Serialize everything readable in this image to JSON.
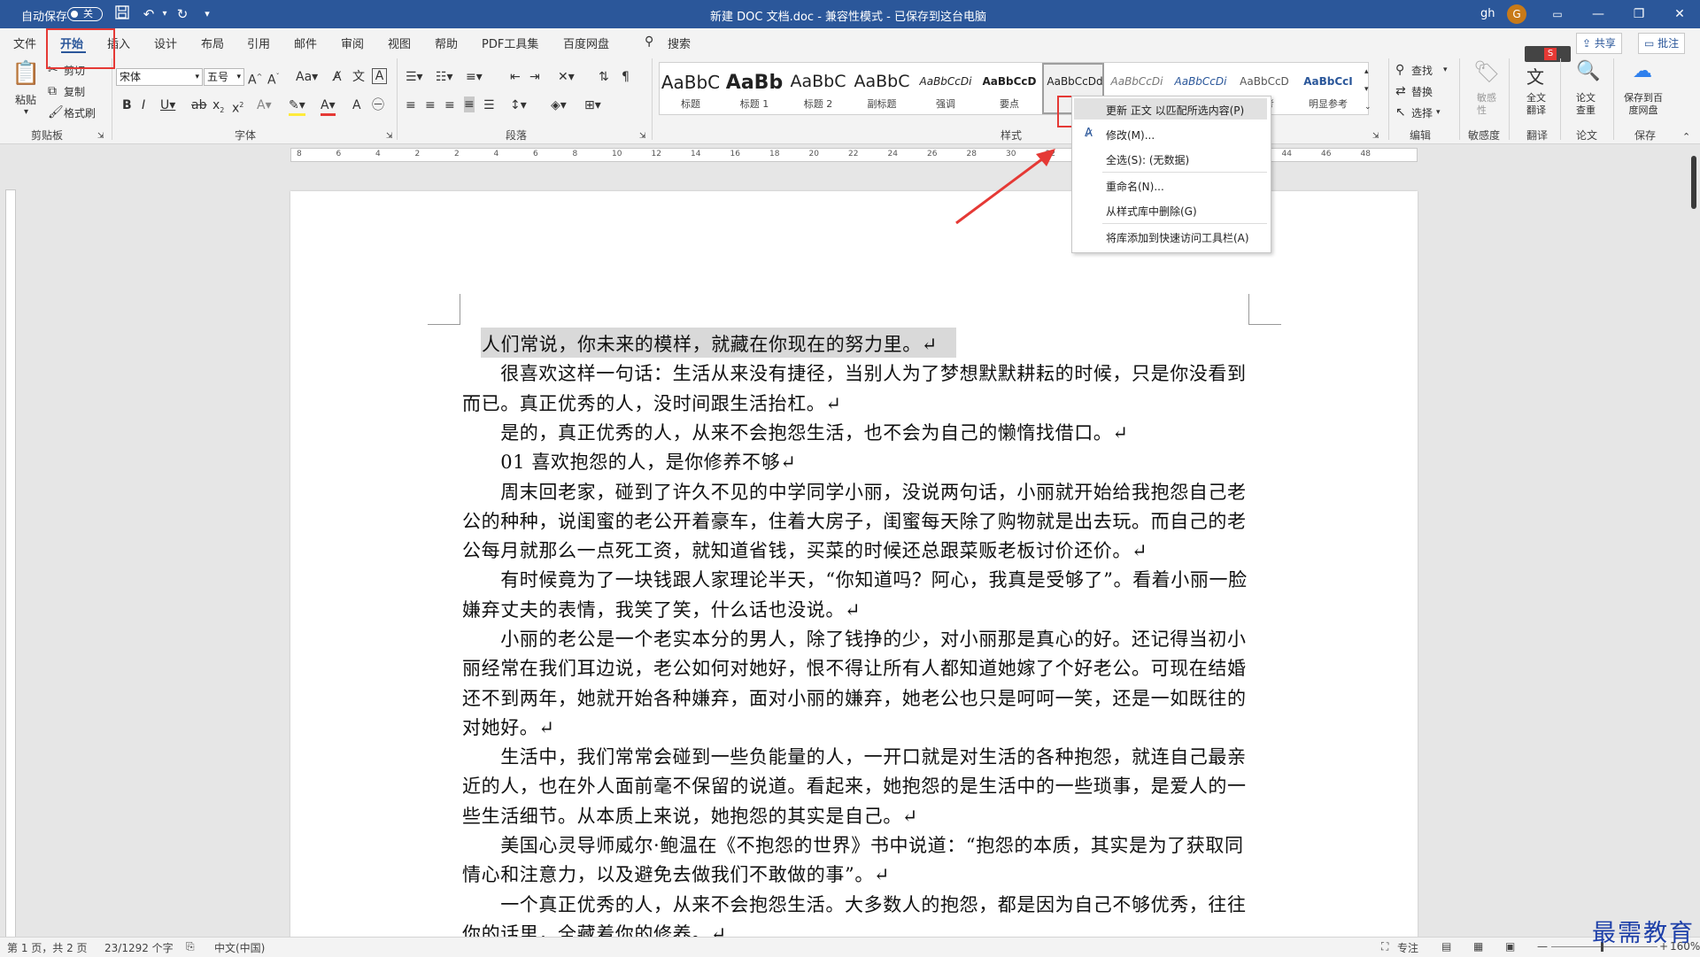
{
  "titlebar": {
    "autosave_label": "自动保存",
    "autosave_state": "关",
    "document_title": "新建 DOC 文档.doc  -  兼容性模式  -  已保存到这台电脑",
    "user_name": "gh",
    "user_initial": "G"
  },
  "tabs": [
    "文件",
    "开始",
    "插入",
    "设计",
    "布局",
    "引用",
    "邮件",
    "审阅",
    "视图",
    "帮助",
    "PDF工具集",
    "百度网盘"
  ],
  "active_tab": "开始",
  "search_label": "搜索",
  "share_label": "共享",
  "comment_label": "批注",
  "clipboard": {
    "paste": "粘贴",
    "cut": "剪切",
    "copy": "复制",
    "format_painter": "格式刷",
    "group_label": "剪贴板"
  },
  "font": {
    "font_name": "宋体",
    "font_size": "五号",
    "group_label": "字体"
  },
  "paragraph": {
    "group_label": "段落"
  },
  "styles": {
    "group_label": "样式",
    "items": [
      {
        "sample": "AaBbC",
        "name": "标题"
      },
      {
        "sample": "AaBb",
        "name": "标题 1"
      },
      {
        "sample": "AaBbC",
        "name": "标题 2"
      },
      {
        "sample": "AaBbC",
        "name": "副标题"
      },
      {
        "sample": "AaBbCcDi",
        "name": "强调"
      },
      {
        "sample": "AaBbCcD",
        "name": "要点"
      },
      {
        "sample": "AaBbCcDd",
        "name": ""
      },
      {
        "sample": "AaBbCcDi",
        "name": ""
      },
      {
        "sample": "AaBbCcDi",
        "name": ""
      },
      {
        "sample": "AaBbCcD",
        "name": "参考"
      },
      {
        "sample": "AaBbCcI",
        "name": "明显参考"
      }
    ]
  },
  "editing": {
    "find": "查找",
    "replace": "替换",
    "select": "选择",
    "group_label": "编辑"
  },
  "sensitivity": {
    "button": "敏感性",
    "group_label": "敏感度"
  },
  "translate": {
    "button": "全文翻译",
    "group_label": "翻译"
  },
  "paper": {
    "button": "论文查重",
    "group_label": "论文"
  },
  "save_group": {
    "button": "保存到百度网盘",
    "group_label": "保存"
  },
  "context_menu": {
    "items": [
      "更新 正文 以匹配所选内容(P)",
      "修改(M)...",
      "全选(S): (无数据)",
      "重命名(N)...",
      "从样式库中删除(G)",
      "将库添加到快速访问工具栏(A)"
    ]
  },
  "ruler_numbers": [
    "8",
    "6",
    "4",
    "2",
    "2",
    "4",
    "6",
    "8",
    "10",
    "12",
    "14",
    "16",
    "18",
    "20",
    "22",
    "24",
    "26",
    "28",
    "30",
    "32",
    "34",
    "36",
    "38",
    "40",
    "42",
    "44",
    "46",
    "48"
  ],
  "document": {
    "paragraphs": [
      "人们常说，你未来的模样，就藏在你现在的努力里。↵",
      "　　很喜欢这样一句话：生活从来没有捷径，当别人为了梦想默默耕耘的时候，只是你没看到而已。真正优秀的人，没时间跟生活抬杠。↵",
      "　　是的，真正优秀的人，从来不会抱怨生活，也不会为自己的懒惰找借口。↵",
      "　　01 喜欢抱怨的人，是你修养不够↵",
      "　　周末回老家，碰到了许久不见的中学同学小丽，没说两句话，小丽就开始给我抱怨自己老公的种种，说闺蜜的老公开着豪车，住着大房子，闺蜜每天除了购物就是出去玩。而自己的老公每月就那么一点死工资，就知道省钱，买菜的时候还总跟菜贩老板讨价还价。↵",
      "　　有时候竟为了一块钱跟人家理论半天，“你知道吗？阿心，我真是受够了”。看着小丽一脸嫌弃丈夫的表情，我笑了笑，什么话也没说。↵",
      "　　小丽的老公是一个老实本分的男人，除了钱挣的少，对小丽那是真心的好。还记得当初小丽经常在我们耳边说，老公如何对她好，恨不得让所有人都知道她嫁了个好老公。可现在结婚还不到两年，她就开始各种嫌弃，面对小丽的嫌弃，她老公也只是呵呵一笑，还是一如既往的对她好。↵",
      "　　生活中，我们常常会碰到一些负能量的人，一开口就是对生活的各种抱怨，就连自己最亲近的人，也在外人面前毫不保留的说道。看起来，她抱怨的是生活中的一些琐事，是爱人的一些生活细节。从本质上来说，她抱怨的其实是自己。↵",
      "　　美国心灵导师威尔·鲍温在《不抱怨的世界》书中说道：“抱怨的本质，其实是为了获取同情心和注意力，以及避免去做我们不敢做的事”。↵",
      "　　一个真正优秀的人，从来不会抱怨生活。大多数人的抱怨，都是因为自己不够优秀，往往你的话里，全藏着你的修养。↵"
    ]
  },
  "statusbar": {
    "page": "第 1 页，共 2 页",
    "words": "23/1292 个字",
    "language": "中文(中国)",
    "focus": "专注",
    "zoom": "160%"
  },
  "watermark": "最需教育"
}
